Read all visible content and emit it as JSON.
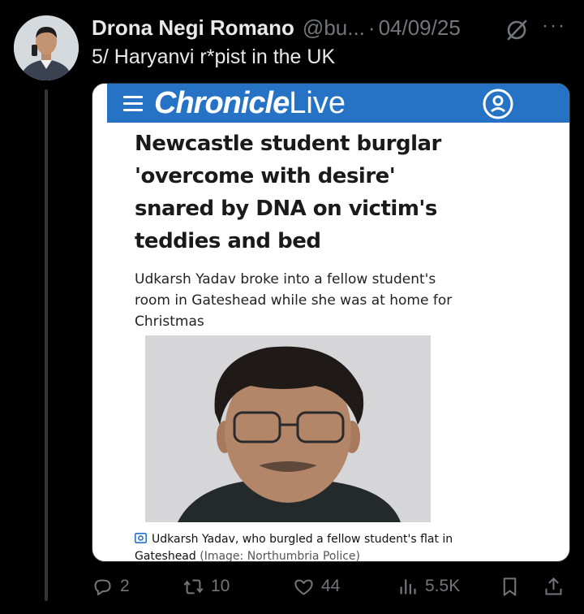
{
  "tweet": {
    "author_name": "Drona Negi Romano",
    "handle": "@bu...",
    "separator": "·",
    "date": "04/09/25",
    "text": "5/ Haryanvi r*pist in the UK",
    "more_label": "···"
  },
  "article": {
    "site_brand_bold": "Chronicle",
    "site_brand_light": "Live",
    "headline": "Newcastle student burglar 'overcome with desire' snared by DNA on victim's teddies and bed",
    "standfirst": "Udkarsh Yadav broke into a fellow student's room in Gateshead while she was at home for Christmas",
    "caption": "Udkarsh Yadav, who burgled a fellow student's flat in Gateshead",
    "credit": "(Image: Northumbria Police)",
    "brand_color": "#2673c5"
  },
  "actions": {
    "replies": "2",
    "retweets": "10",
    "likes": "44",
    "views": "5.5K"
  },
  "icons": [
    "reply-icon",
    "retweet-icon",
    "like-icon",
    "views-icon",
    "bookmark-icon",
    "share-icon",
    "grok-icon",
    "menu-icon",
    "account-icon",
    "camera-icon"
  ]
}
